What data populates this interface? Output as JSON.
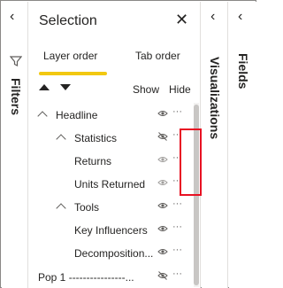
{
  "filters": {
    "label": "Filters",
    "collapse_icon": "chevron-left-icon",
    "filter_icon": "funnel-icon"
  },
  "selection": {
    "title": "Selection",
    "close_icon": "close-icon",
    "tabs": [
      {
        "label": "Layer order",
        "active": true
      },
      {
        "label": "Tab order",
        "active": false
      }
    ],
    "move_up_icon": "triangle-up-icon",
    "move_down_icon": "triangle-down-icon",
    "show_label": "Show",
    "hide_label": "Hide",
    "layers": [
      {
        "label": "Headline",
        "expandable": true,
        "expanded": true,
        "eye": "visible"
      },
      {
        "label": "Statistics",
        "expandable": true,
        "expanded": true,
        "eye": "hidden"
      },
      {
        "label": "Returns",
        "expandable": false,
        "eye": "visible-faded"
      },
      {
        "label": "Units Returned",
        "expandable": false,
        "eye": "visible-faded"
      },
      {
        "label": "Tools",
        "expandable": true,
        "expanded": true,
        "eye": "visible"
      },
      {
        "label": "Key Influencers",
        "expandable": false,
        "eye": "visible"
      },
      {
        "label": "Decomposition...",
        "expandable": false,
        "eye": "visible"
      },
      {
        "label": "Pop 1 ----------------...",
        "expandable": false,
        "eye": "hidden"
      }
    ],
    "more_label": "···"
  },
  "visualizations": {
    "label": "Visualizations",
    "collapse_icon": "chevron-left-icon"
  },
  "fields": {
    "label": "Fields",
    "collapse_icon": "chevron-left-icon"
  },
  "colors": {
    "accent": "#f2c811",
    "highlight": "#e81123",
    "text": "#252423",
    "muted": "#605e5c"
  }
}
